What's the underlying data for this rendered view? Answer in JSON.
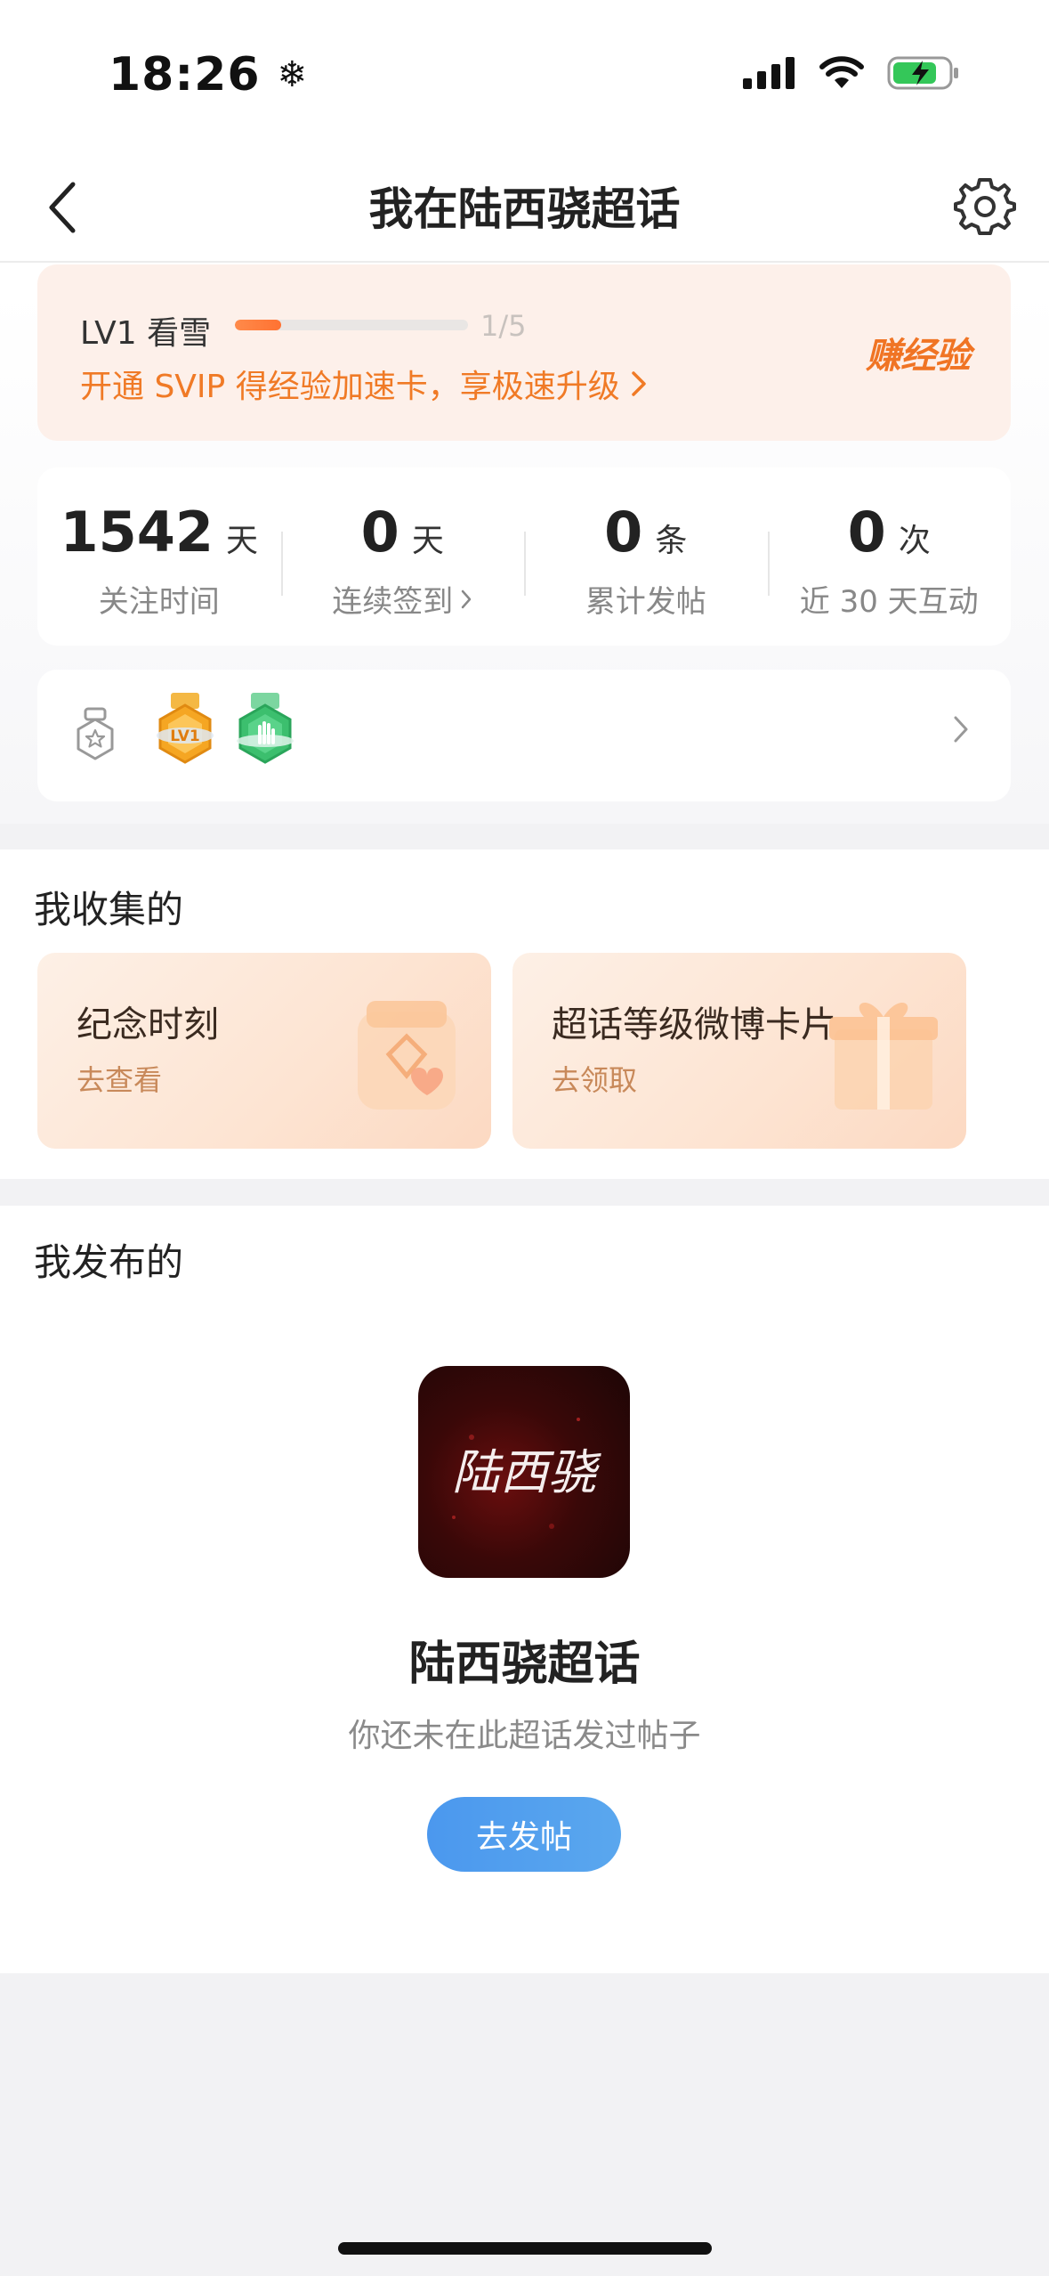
{
  "status_bar": {
    "time": "18:26",
    "extra_icon": "snowflake-icon",
    "icons": [
      "signal-icon",
      "wifi-icon",
      "battery-charging-icon"
    ]
  },
  "nav": {
    "title": "我在陆西骁超话",
    "back_icon": "chevron-left-icon",
    "settings_icon": "gear-icon"
  },
  "level": {
    "name": "LV1 看雪",
    "progress_text": "1/5",
    "progress_fraction": 0.2,
    "promo": "开通 SVIP 得经验加速卡，享极速升级",
    "earn_exp": "赚经验"
  },
  "stats": [
    {
      "value": "1542",
      "unit": "天",
      "label": "关注时间",
      "link": false
    },
    {
      "value": "0",
      "unit": "天",
      "label": "连续签到",
      "link": true
    },
    {
      "value": "0",
      "unit": "条",
      "label": "累计发帖",
      "link": false
    },
    {
      "value": "0",
      "unit": "次",
      "label": "近 30 天互动",
      "link": false
    }
  ],
  "badges": {
    "items": [
      "lv1-badge-icon",
      "hand-badge-icon"
    ],
    "lv1_text": "LV1"
  },
  "collect": {
    "title": "我收集的",
    "cards": [
      {
        "title": "纪念时刻",
        "sub": "去查看"
      },
      {
        "title": "超话等级微博卡片",
        "sub": "去领取"
      }
    ]
  },
  "posts": {
    "title": "我发布的",
    "avatar_text": "陆西骁",
    "topic_name": "陆西骁超话",
    "empty_text": "你还未在此超话发过帖子",
    "button": "去发帖"
  },
  "colors": {
    "accent_orange": "#f07a26",
    "button_blue": "#4b98ee"
  }
}
